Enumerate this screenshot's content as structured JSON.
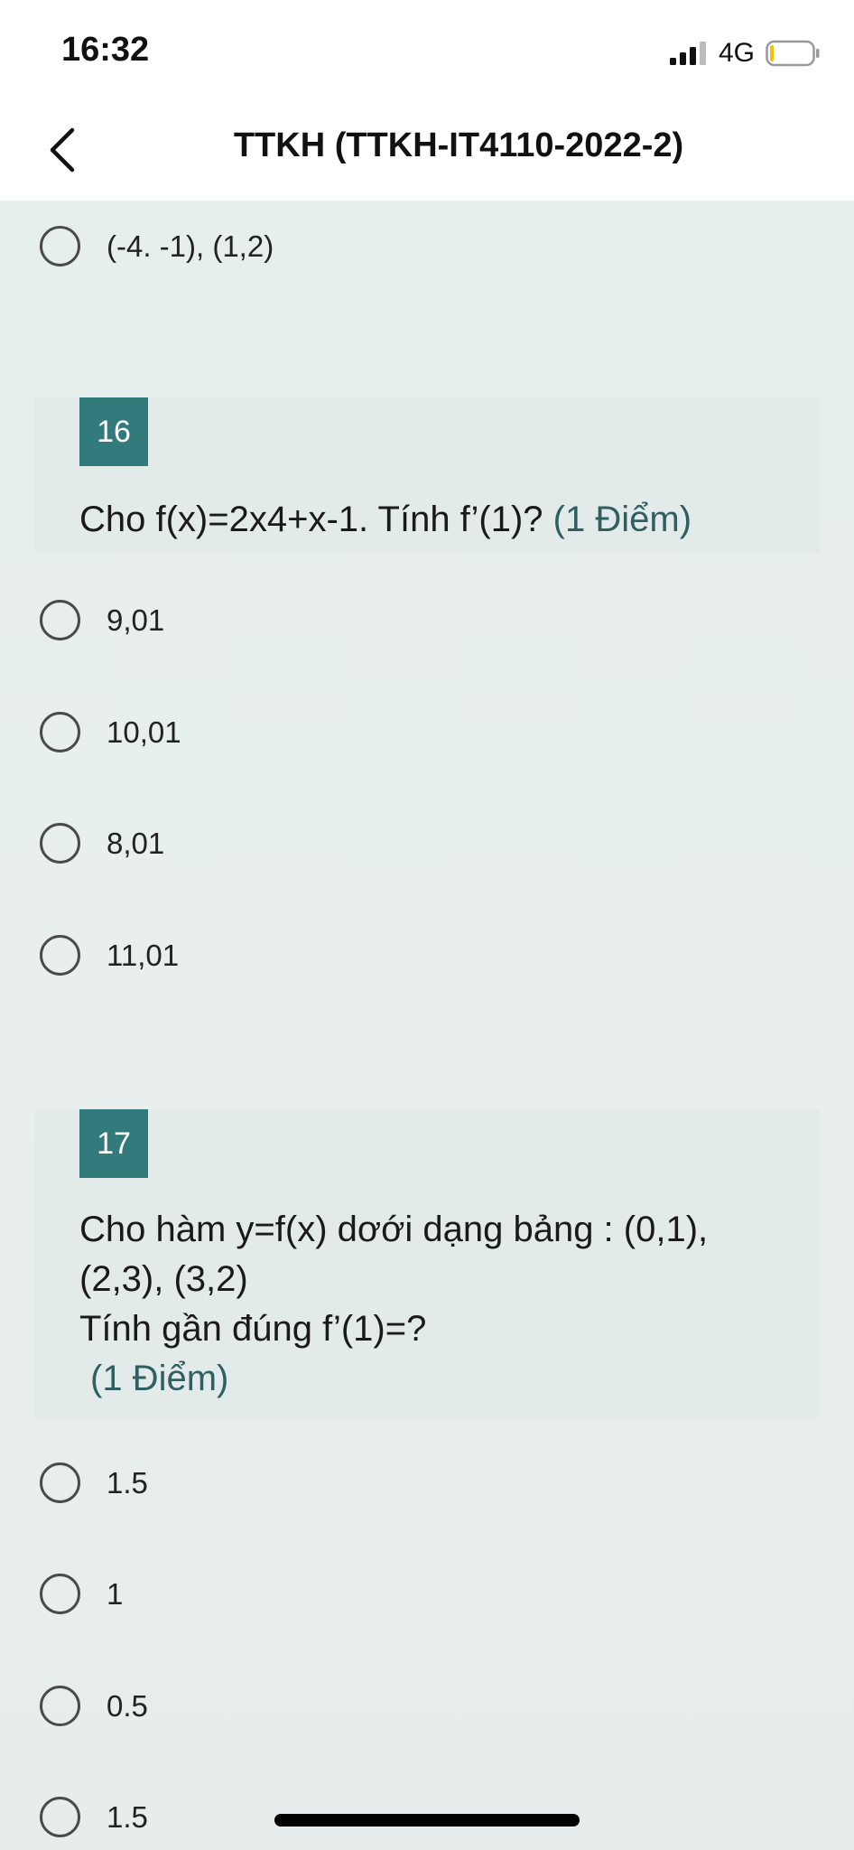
{
  "status_bar": {
    "time": "16:32",
    "network": "4G",
    "icons": [
      "signal-icon",
      "battery-icon"
    ]
  },
  "nav": {
    "back_icon": "chevron-left-icon",
    "title": "TTKH (TTKH-IT4110-2022-2)"
  },
  "prev_question": {
    "last_option": "(-4. -1), (1,2)"
  },
  "questions": [
    {
      "number": "16",
      "text": "Cho f(x)=2x4+x-1. Tính f’(1)?",
      "points": "(1 Điểm)",
      "options": [
        "9,01",
        "10,01",
        "8,01",
        "11,01"
      ]
    },
    {
      "number": "17",
      "text_line1": "Cho hàm y=f(x) dơới dạng bảng : (0,1),",
      "text_line2": "(2,3), (3,2)",
      "text_line3": "Tính gần đúng f’(1)=?",
      "points": "(1 Điểm)",
      "options": [
        "1.5",
        "1",
        "0.5",
        "1.5"
      ]
    }
  ],
  "colors": {
    "accent": "#337a7d",
    "points_text": "#2f5f61",
    "background": "#e8eeee"
  }
}
